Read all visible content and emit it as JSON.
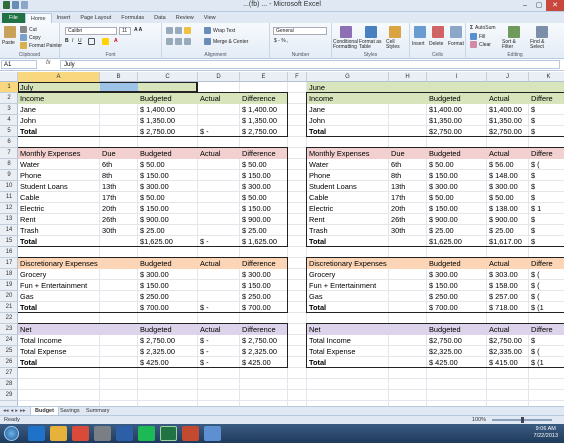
{
  "window": {
    "title": "Microsoft Excel",
    "title_prefix": "...(fb) ...",
    "controls": [
      "–",
      "▢",
      "✕"
    ]
  },
  "tabs": [
    "File",
    "Home",
    "Insert",
    "Page Layout",
    "Formulas",
    "Data",
    "Review",
    "View"
  ],
  "active_tab": "Home",
  "ribbon": {
    "clipboard": {
      "paste": "Paste",
      "cut": "Cut",
      "copy": "Copy",
      "format_painter": "Format Painter",
      "label": "Clipboard"
    },
    "font": {
      "name": "Calibri",
      "size": "11",
      "label": "Font"
    },
    "alignment": {
      "wrap": "Wrap Text",
      "merge": "Merge & Center",
      "label": "Alignment"
    },
    "number": {
      "format": "General",
      "symbols": "$ - % ,",
      "label": "Number"
    },
    "styles": {
      "conditional": "Conditional Formatting",
      "format_table": "Format as Table",
      "cell_styles": "Cell Styles",
      "label": "Styles"
    },
    "cells": {
      "insert": "Insert",
      "delete": "Delete",
      "format": "Format",
      "label": "Cells"
    },
    "editing": {
      "autosum": "AutoSum",
      "fill": "Fill",
      "clear": "Clear",
      "sort": "Sort & Filter",
      "find": "Find & Select",
      "label": "Editing"
    }
  },
  "formula_bar": {
    "name_box": "A1",
    "fx": "fx",
    "value": "July"
  },
  "columns": [
    "A",
    "B",
    "C",
    "D",
    "E",
    "F",
    "G",
    "H",
    "I",
    "J",
    "K"
  ],
  "rows": [
    "1",
    "2",
    "3",
    "4",
    "5",
    "6",
    "7",
    "8",
    "9",
    "10",
    "11",
    "12",
    "13",
    "14",
    "15",
    "16",
    "17",
    "18",
    "19",
    "20",
    "21",
    "22",
    "23",
    "24",
    "25",
    "26",
    "27",
    "28",
    "29"
  ],
  "colors": {
    "green": "#d7e4bc",
    "pink": "#f2d0d0",
    "orange": "#fbd5b5",
    "purple": "#ddd4ec",
    "blue_sel": "#9dc3e6"
  },
  "sheet": {
    "left": {
      "month": "July",
      "income": {
        "header": "Income",
        "col_budgeted": "Budgeted",
        "col_actual": "Actual",
        "col_difference": "Difference",
        "rows": [
          {
            "name": "Jane",
            "budgeted": "$ 1,400.00",
            "actual": "",
            "difference": "$ 1,400.00"
          },
          {
            "name": "John",
            "budgeted": "$ 1,350.00",
            "actual": "",
            "difference": "$ 1,350.00"
          },
          {
            "name": "Total",
            "budgeted": "$ 2,750.00",
            "actual": "$ -",
            "difference": "$ 2,750.00"
          }
        ]
      },
      "monthly": {
        "header": "Monthly Expenses",
        "col_due": "Due",
        "col_budgeted": "Budgeted",
        "col_actual": "Actual",
        "col_difference": "Difference",
        "rows": [
          {
            "name": "Water",
            "due": "6th",
            "budgeted": "$ 50.00",
            "actual": "",
            "difference": "$ 50.00"
          },
          {
            "name": "Phone",
            "due": "8th",
            "budgeted": "$ 150.00",
            "actual": "",
            "difference": "$ 150.00"
          },
          {
            "name": "Student Loans",
            "due": "13th",
            "budgeted": "$ 300.00",
            "actual": "",
            "difference": "$ 300.00"
          },
          {
            "name": "Cable",
            "due": "17th",
            "budgeted": "$ 50.00",
            "actual": "",
            "difference": "$ 50.00"
          },
          {
            "name": "Electric",
            "due": "20th",
            "budgeted": "$ 150.00",
            "actual": "",
            "difference": "$ 150.00"
          },
          {
            "name": "Rent",
            "due": "26th",
            "budgeted": "$ 900.00",
            "actual": "",
            "difference": "$ 900.00"
          },
          {
            "name": "Trash",
            "due": "30th",
            "budgeted": "$ 25.00",
            "actual": "",
            "difference": "$ 25.00"
          },
          {
            "name": "Total",
            "due": "",
            "budgeted": "$1,625.00",
            "actual": "$ -",
            "difference": "$ 1,625.00"
          }
        ]
      },
      "discretionary": {
        "header": "Discretionary Expenses",
        "col_budgeted": "Budgeted",
        "col_actual": "Actual",
        "col_difference": "Difference",
        "rows": [
          {
            "name": "Grocery",
            "budgeted": "$ 300.00",
            "actual": "",
            "difference": "$ 300.00"
          },
          {
            "name": "Fun + Entertainment",
            "budgeted": "$ 150.00",
            "actual": "",
            "difference": "$ 150.00"
          },
          {
            "name": "Gas",
            "budgeted": "$ 250.00",
            "actual": "",
            "difference": "$ 250.00"
          },
          {
            "name": "Total",
            "budgeted": "$ 700.00",
            "actual": "$ -",
            "difference": "$ 700.00"
          }
        ]
      },
      "net": {
        "header": "Net",
        "col_budgeted": "Budgeted",
        "col_actual": "Actual",
        "col_difference": "Difference",
        "rows": [
          {
            "name": "Total Income",
            "budgeted": "$ 2,750.00",
            "actual": "$ -",
            "difference": "$ 2,750.00"
          },
          {
            "name": "Total Expense",
            "budgeted": "$ 2,325.00",
            "actual": "$ -",
            "difference": "$ 2,325.00"
          },
          {
            "name": "Total",
            "budgeted": "$ 425.00",
            "actual": "$ -",
            "difference": "$ 425.00"
          }
        ]
      }
    },
    "right": {
      "month": "June",
      "income": {
        "header": "Income",
        "col_budgeted": "Budgeted",
        "col_actual": "Actual",
        "col_difference": "Differe",
        "rows": [
          {
            "name": "Jane",
            "budgeted": "$1,400.00",
            "actual": "$1,400.00",
            "difference": "$"
          },
          {
            "name": "John",
            "budgeted": "$1,350.00",
            "actual": "$1,350.00",
            "difference": "$"
          },
          {
            "name": "Total",
            "budgeted": "$2,750.00",
            "actual": "$2,750.00",
            "difference": "$"
          }
        ]
      },
      "monthly": {
        "header": "Monthly Expenses",
        "col_due": "Due",
        "col_budgeted": "Budgeted",
        "col_actual": "Actual",
        "col_difference": "Differe",
        "rows": [
          {
            "name": "Water",
            "due": "6th",
            "budgeted": "$ 50.00",
            "actual": "$ 56.00",
            "difference": "$ ("
          },
          {
            "name": "Phone",
            "due": "8th",
            "budgeted": "$ 150.00",
            "actual": "$ 148.00",
            "difference": "$"
          },
          {
            "name": "Student Loans",
            "due": "13th",
            "budgeted": "$ 300.00",
            "actual": "$ 300.00",
            "difference": "$"
          },
          {
            "name": "Cable",
            "due": "17th",
            "budgeted": "$ 50.00",
            "actual": "$ 50.00",
            "difference": "$"
          },
          {
            "name": "Electric",
            "due": "20th",
            "budgeted": "$ 150.00",
            "actual": "$ 138.00",
            "difference": "$ 1"
          },
          {
            "name": "Rent",
            "due": "26th",
            "budgeted": "$ 900.00",
            "actual": "$ 900.00",
            "difference": "$"
          },
          {
            "name": "Trash",
            "due": "30th",
            "budgeted": "$ 25.00",
            "actual": "$ 25.00",
            "difference": "$"
          },
          {
            "name": "Total",
            "due": "",
            "budgeted": "$1,625.00",
            "actual": "$1,617.00",
            "difference": "$"
          }
        ]
      },
      "discretionary": {
        "header": "Discretionary Expenses",
        "col_budgeted": "Budgeted",
        "col_actual": "Actual",
        "col_difference": "Differe",
        "rows": [
          {
            "name": "Grocery",
            "budgeted": "$ 300.00",
            "actual": "$ 303.00",
            "difference": "$ ("
          },
          {
            "name": "Fun + Entertainment",
            "budgeted": "$ 150.00",
            "actual": "$ 158.00",
            "difference": "$ ("
          },
          {
            "name": "Gas",
            "budgeted": "$ 250.00",
            "actual": "$ 257.00",
            "difference": "$ ("
          },
          {
            "name": "Total",
            "budgeted": "$ 700.00",
            "actual": "$ 718.00",
            "difference": "$ (1"
          }
        ]
      },
      "net": {
        "header": "Net",
        "col_budgeted": "Budgeted",
        "col_actual": "Actual",
        "col_difference": "Differe",
        "rows": [
          {
            "name": "Total Income",
            "budgeted": "$2,750.00",
            "actual": "$2,750.00",
            "difference": "$"
          },
          {
            "name": "Total Expense",
            "budgeted": "$2,325.00",
            "actual": "$2,335.00",
            "difference": "$ ("
          },
          {
            "name": "Total",
            "budgeted": "$ 425.00",
            "actual": "$ 415.00",
            "difference": "$ (1"
          }
        ]
      }
    }
  },
  "sheet_tabs": [
    "Budget",
    "Savings",
    "Summary"
  ],
  "active_sheet": "Budget",
  "status": {
    "ready": "Ready",
    "zoom": "100%"
  },
  "clock": {
    "time": "9:06 AM",
    "date": "7/22/2013"
  }
}
